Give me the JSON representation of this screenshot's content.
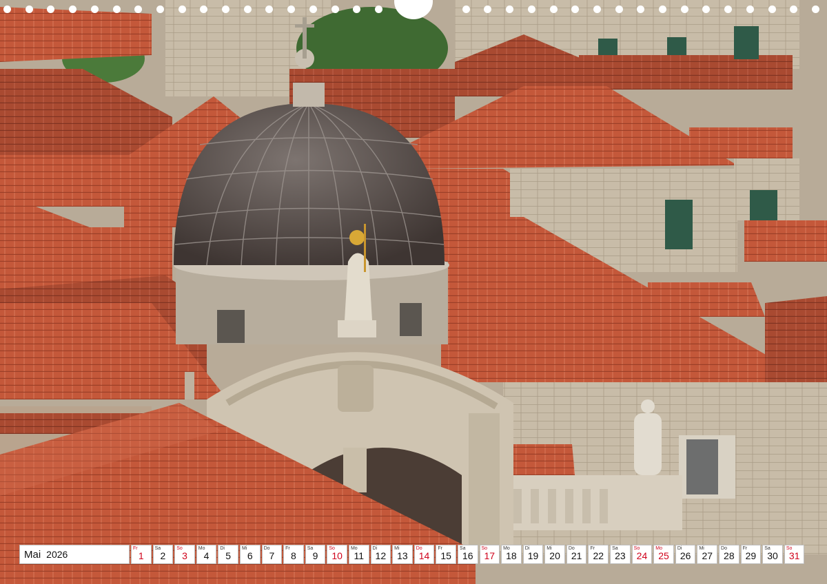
{
  "calendar": {
    "month": "Mai",
    "year": "2026",
    "days": [
      {
        "wd": "Fr",
        "num": "1",
        "red": true
      },
      {
        "wd": "Sa",
        "num": "2",
        "red": false
      },
      {
        "wd": "So",
        "num": "3",
        "red": true
      },
      {
        "wd": "Mo",
        "num": "4",
        "red": false
      },
      {
        "wd": "Di",
        "num": "5",
        "red": false
      },
      {
        "wd": "Mi",
        "num": "6",
        "red": false
      },
      {
        "wd": "Do",
        "num": "7",
        "red": false
      },
      {
        "wd": "Fr",
        "num": "8",
        "red": false
      },
      {
        "wd": "Sa",
        "num": "9",
        "red": false
      },
      {
        "wd": "So",
        "num": "10",
        "red": true
      },
      {
        "wd": "Mo",
        "num": "11",
        "red": false
      },
      {
        "wd": "Di",
        "num": "12",
        "red": false
      },
      {
        "wd": "Mi",
        "num": "13",
        "red": false
      },
      {
        "wd": "Do",
        "num": "14",
        "red": true
      },
      {
        "wd": "Fr",
        "num": "15",
        "red": false
      },
      {
        "wd": "Sa",
        "num": "16",
        "red": false
      },
      {
        "wd": "So",
        "num": "17",
        "red": true
      },
      {
        "wd": "Mo",
        "num": "18",
        "red": false
      },
      {
        "wd": "Di",
        "num": "19",
        "red": false
      },
      {
        "wd": "Mi",
        "num": "20",
        "red": false
      },
      {
        "wd": "Do",
        "num": "21",
        "red": false
      },
      {
        "wd": "Fr",
        "num": "22",
        "red": false
      },
      {
        "wd": "Sa",
        "num": "23",
        "red": false
      },
      {
        "wd": "So",
        "num": "24",
        "red": true
      },
      {
        "wd": "Mo",
        "num": "25",
        "red": true
      },
      {
        "wd": "Di",
        "num": "26",
        "red": false
      },
      {
        "wd": "Mi",
        "num": "27",
        "red": false
      },
      {
        "wd": "Do",
        "num": "28",
        "red": false
      },
      {
        "wd": "Fr",
        "num": "29",
        "red": false
      },
      {
        "wd": "Sa",
        "num": "30",
        "red": false
      },
      {
        "wd": "So",
        "num": "31",
        "red": true
      }
    ]
  },
  "colors": {
    "holiday_red": "#d0021b",
    "roof_terracotta": "#c45a3a",
    "dome_gray": "#5b524f",
    "stone": "#c9bba6"
  }
}
